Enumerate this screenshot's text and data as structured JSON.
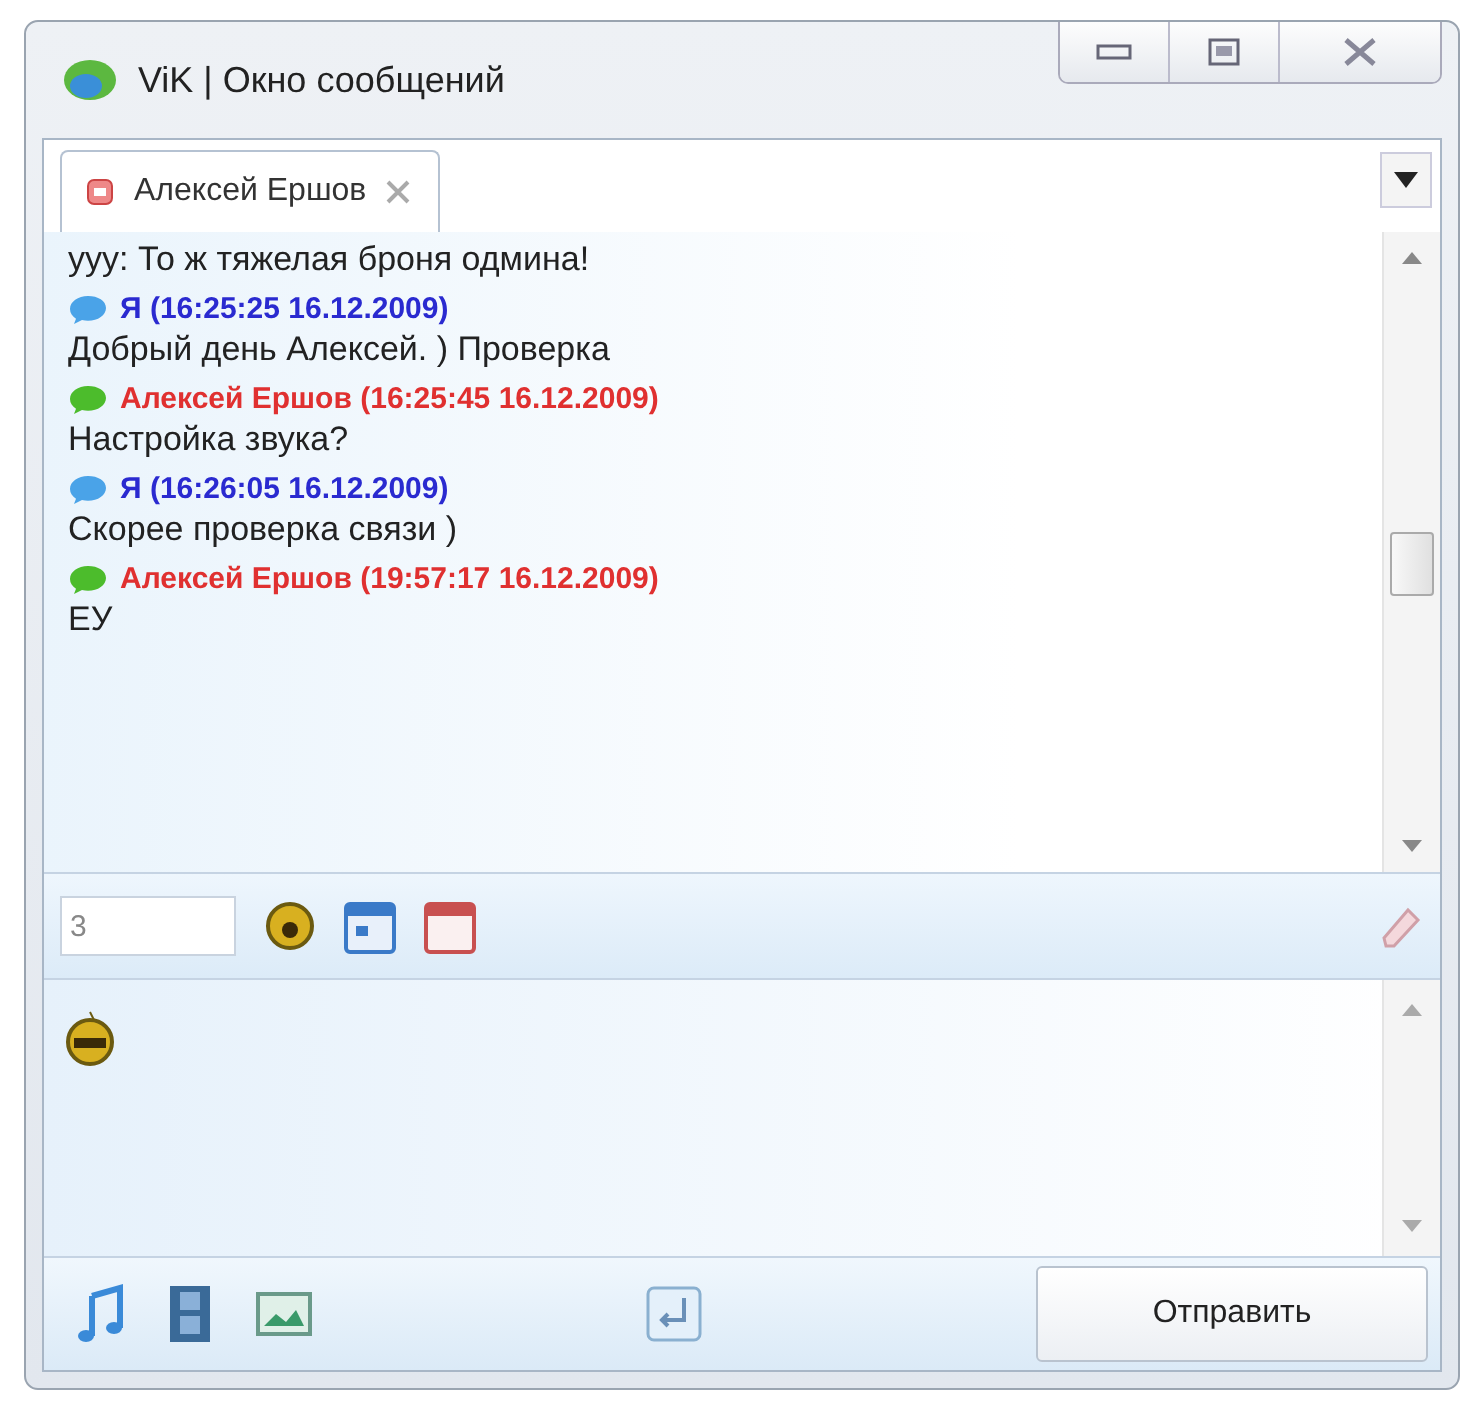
{
  "window": {
    "title": "ViK | Окно сообщений"
  },
  "tabs": [
    {
      "label": "Алексей Ершов",
      "selected": true
    }
  ],
  "messages": [
    {
      "kind": "line",
      "text": "ууу: То ж тяжелая броня одмина!"
    },
    {
      "kind": "header",
      "text": "Я (16:25:25 16.12.2009)",
      "color": "#2a2ad0"
    },
    {
      "kind": "line",
      "text": "Добрый день Алексей. ) Проверка"
    },
    {
      "kind": "header",
      "text": "Алексей Ершов (16:25:45 16.12.2009)",
      "color": "#e03030"
    },
    {
      "kind": "line",
      "text": "Настройка звука?"
    },
    {
      "kind": "header",
      "text": "Я (16:26:05 16.12.2009)",
      "color": "#2a2ad0"
    },
    {
      "kind": "line",
      "text": "Скорее проверка связи )"
    },
    {
      "kind": "header",
      "text": "Алексей Ершов (19:57:17 16.12.2009)",
      "color": "#e03030"
    },
    {
      "kind": "line",
      "text": "ЕУ"
    }
  ],
  "toolbar": {
    "font_size_field": {
      "value": "3"
    }
  },
  "send_button": {
    "label": "Отправить"
  }
}
